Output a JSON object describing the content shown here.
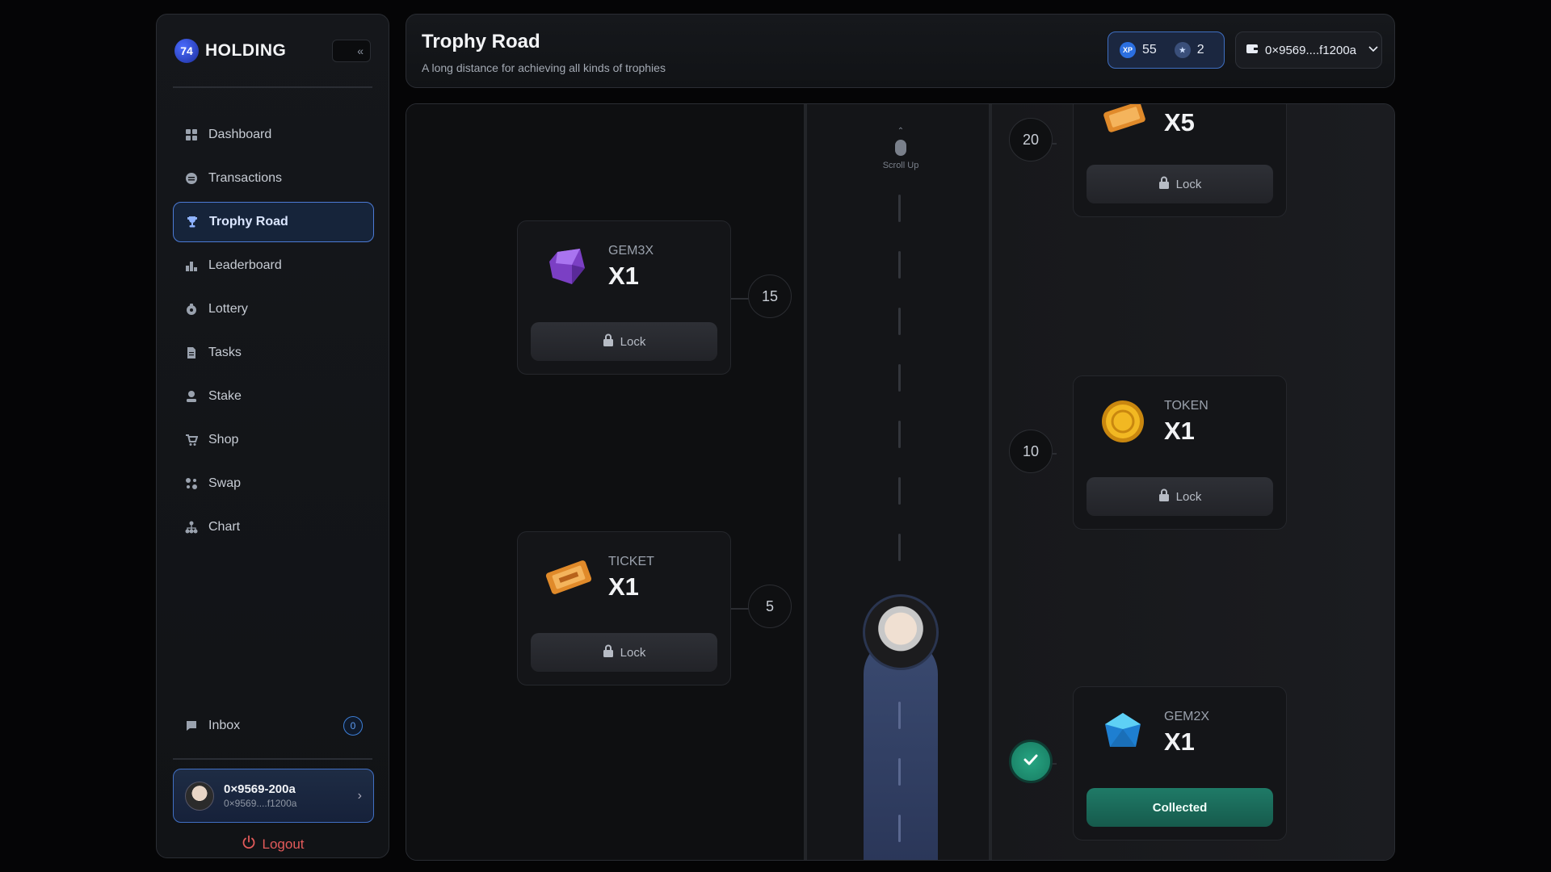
{
  "brand": {
    "name": "HOLDING",
    "mark": "74"
  },
  "sidebar": {
    "items": [
      {
        "label": "Dashboard",
        "icon": "grid-icon"
      },
      {
        "label": "Transactions",
        "icon": "transfer-icon"
      },
      {
        "label": "Trophy Road",
        "icon": "trophy-icon"
      },
      {
        "label": "Leaderboard",
        "icon": "podium-icon"
      },
      {
        "label": "Lottery",
        "icon": "ticket-icon"
      },
      {
        "label": "Tasks",
        "icon": "document-icon"
      },
      {
        "label": "Stake",
        "icon": "stake-icon"
      },
      {
        "label": "Shop",
        "icon": "cart-icon"
      },
      {
        "label": "Swap",
        "icon": "swap-icon"
      },
      {
        "label": "Chart",
        "icon": "chart-icon"
      }
    ],
    "active": "Trophy Road",
    "inbox": {
      "label": "Inbox",
      "count": "0"
    },
    "user": {
      "name": "0×9569-200a",
      "address": "0×9569....f1200a"
    },
    "logout": "Logout"
  },
  "header": {
    "title": "Trophy Road",
    "subtitle": "A long distance for achieving all kinds of trophies",
    "xp": "55",
    "stars": "2",
    "wallet": "0×9569....f1200a"
  },
  "road": {
    "scroll_hint": "Scroll Up",
    "rewards": [
      {
        "level": "20",
        "name": "",
        "qty": "X5",
        "status": "Lock",
        "icon": "ticket-icon"
      },
      {
        "level": "15",
        "name": "GEM3X",
        "qty": "X1",
        "status": "Lock",
        "icon": "purple-gem-icon"
      },
      {
        "level": "10",
        "name": "TOKEN",
        "qty": "X1",
        "status": "Lock",
        "icon": "coin-icon"
      },
      {
        "level": "5",
        "name": "TICKET",
        "qty": "X1",
        "status": "Lock",
        "icon": "ticket-icon"
      },
      {
        "level": "",
        "name": "GEM2X",
        "qty": "X1",
        "status": "Collected",
        "icon": "blue-gem-icon"
      }
    ]
  },
  "colors": {
    "accent": "#4c7bd6",
    "collected": "#1f7a67",
    "logout": "#e25a5a"
  }
}
